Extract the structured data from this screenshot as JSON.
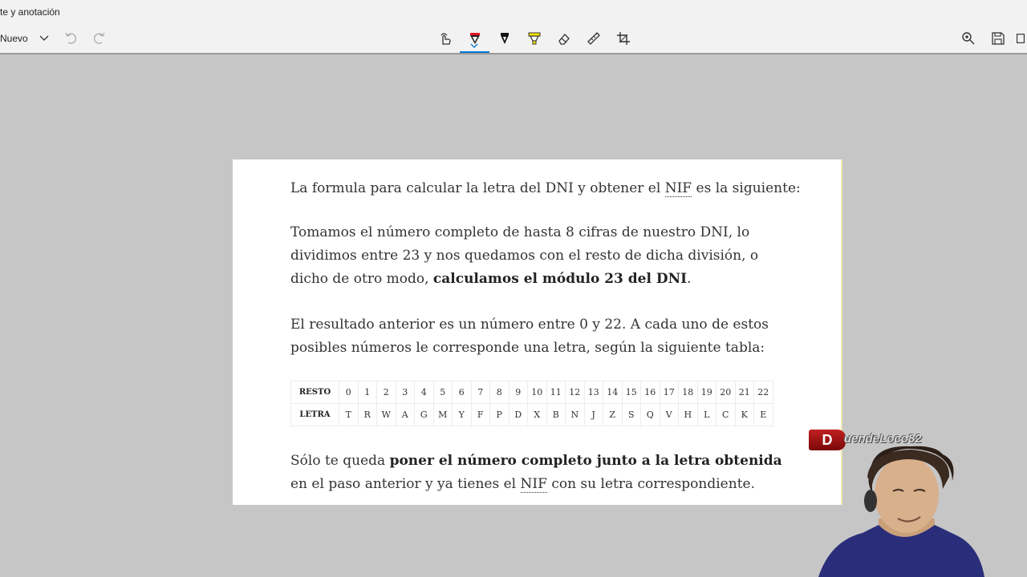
{
  "window": {
    "title": "te y anotación"
  },
  "toolbar": {
    "new_label": "Nuevo",
    "tools": [
      {
        "name": "touch-write-icon"
      },
      {
        "name": "ballpoint-pen-icon",
        "active": true
      },
      {
        "name": "pencil-icon"
      },
      {
        "name": "highlighter-icon"
      },
      {
        "name": "eraser-icon"
      },
      {
        "name": "ruler-icon"
      },
      {
        "name": "crop-icon"
      }
    ],
    "right_tools": [
      {
        "name": "zoom-icon"
      },
      {
        "name": "save-icon"
      },
      {
        "name": "copy-icon"
      }
    ],
    "colors": {
      "pen": "#e81123",
      "highlighter": "#ffe600",
      "accent": "#0078d7"
    }
  },
  "doc": {
    "p1": {
      "before": "La formula para calcular la letra del DNI y obtener el ",
      "abbr": "NIF",
      "after": " es la siguiente:"
    },
    "p2": {
      "before": "Tomamos el número completo de hasta 8 cifras de nuestro DNI, lo dividimos entre 23 y nos quedamos con el resto de dicha división, o dicho de otro modo, ",
      "bold": "calculamos el módulo 23 del DNI",
      "after": "."
    },
    "p3": "El resultado anterior es un número entre 0 y 22. A cada uno de estos posibles números le corresponde una letra, según la siguiente tabla:",
    "table": {
      "row1_header": "RESTO",
      "row2_header": "LETRA",
      "resto": [
        "0",
        "1",
        "2",
        "3",
        "4",
        "5",
        "6",
        "7",
        "8",
        "9",
        "10",
        "11",
        "12",
        "13",
        "14",
        "15",
        "16",
        "17",
        "18",
        "19",
        "20",
        "21",
        "22"
      ],
      "letra": [
        "T",
        "R",
        "W",
        "A",
        "G",
        "M",
        "Y",
        "F",
        "P",
        "D",
        "X",
        "B",
        "N",
        "J",
        "Z",
        "S",
        "Q",
        "V",
        "H",
        "L",
        "C",
        "K",
        "E"
      ]
    },
    "p5": {
      "before": "Sólo te queda ",
      "bold": "poner el número completo junto a la letra obtenida",
      "mid": " en el paso anterior y ya tienes el ",
      "abbr": "NIF",
      "after": " con su letra correspondiente."
    }
  },
  "overlay": {
    "logo_letter": "D",
    "logo_name": "uendeLoco82"
  }
}
